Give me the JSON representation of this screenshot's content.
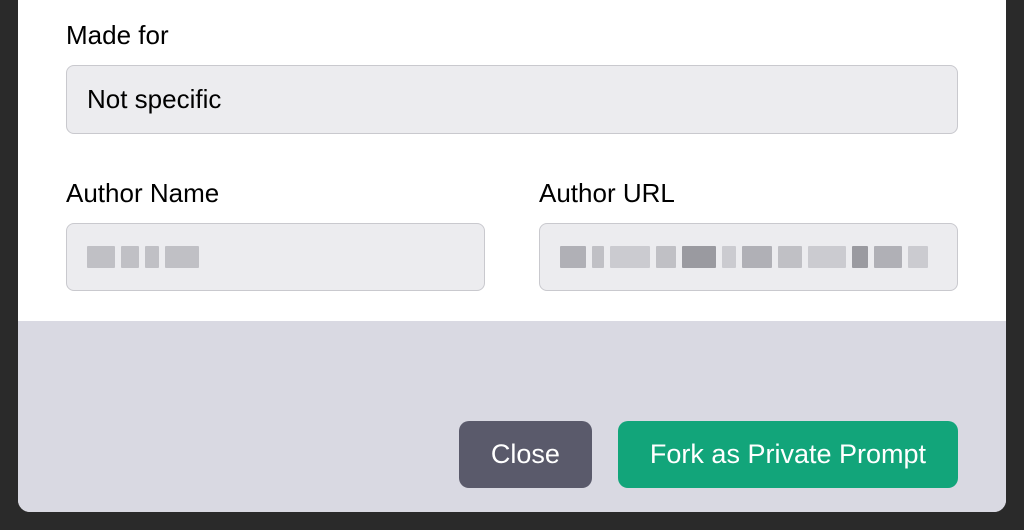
{
  "fields": {
    "made_for": {
      "label": "Made for",
      "value": "Not specific"
    },
    "author_name": {
      "label": "Author Name",
      "value": ""
    },
    "author_url": {
      "label": "Author URL",
      "value": ""
    }
  },
  "footer": {
    "close_label": "Close",
    "fork_label": "Fork as Private Prompt"
  }
}
